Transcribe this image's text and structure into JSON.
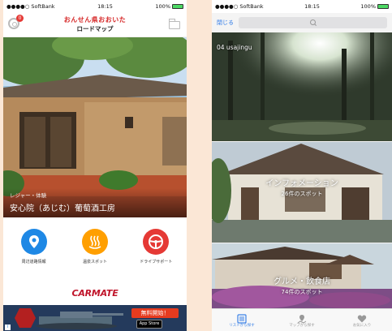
{
  "left": {
    "status": {
      "carrier": "●●●●○ SoftBank",
      "time": "18:15",
      "battery": "100%"
    },
    "header": {
      "title": "おんせん県おおいた",
      "subtitle": "ロードマップ",
      "badge": "0"
    },
    "hero": {
      "tag": "レジャー・体験",
      "title": "安心院（あじむ）葡萄酒工房"
    },
    "menu": [
      {
        "label": "周辺道路情報",
        "color": "#1e88e5"
      },
      {
        "label": "温泉スポット",
        "color": "#ff9f00"
      },
      {
        "label": "ドライブサポート",
        "color": "#e53935"
      }
    ],
    "brand": "CARMATE",
    "ad": {
      "button": "無料開始！",
      "store": "App Store"
    }
  },
  "right": {
    "status": {
      "carrier": "●●●●○ SoftBank",
      "time": "18:15",
      "battery": "100%"
    },
    "close_label": "閉じる",
    "cards": [
      {
        "label": "04 usajingu"
      },
      {
        "title": "インフォメーション",
        "count": "26件のスポット"
      },
      {
        "title": "グルメ・飲食店",
        "count": "74件のスポット"
      }
    ],
    "tabs": [
      {
        "label": "リストから探す",
        "active": true
      },
      {
        "label": "マップから探す",
        "active": false
      },
      {
        "label": "お気に入り",
        "active": false
      }
    ]
  }
}
